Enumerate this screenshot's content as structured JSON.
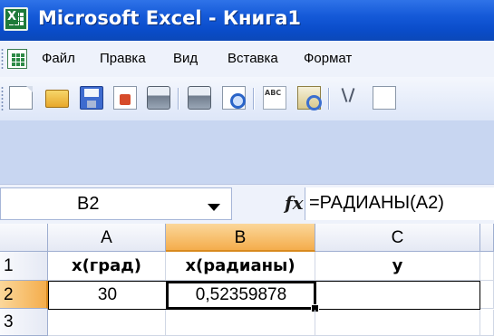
{
  "window": {
    "title": "Microsoft Excel - Книга1",
    "icon": "excel-app-icon"
  },
  "menu": {
    "items": [
      "Файл",
      "Правка",
      "Вид",
      "Вставка",
      "Формат"
    ]
  },
  "toolbar": {
    "icons": [
      "new-icon",
      "open-icon",
      "save-icon",
      "permission-icon",
      "print-icon",
      "print-preview-icon",
      "spelling-icon",
      "research-icon",
      "cut-icon",
      "copy-icon"
    ]
  },
  "formula_bar": {
    "name_box": "B2",
    "fx_icon": "fx-icon",
    "formula": "=РАДИАНЫ(A2)"
  },
  "sheet": {
    "columns": [
      "A",
      "B",
      "C"
    ],
    "selected_column": "B",
    "rows": [
      "1",
      "2",
      "3"
    ],
    "selected_row": "2",
    "cells": {
      "A1": "x(град)",
      "B1": "x(радианы)",
      "C1": "y",
      "A2": "30",
      "B2": "0,52359878",
      "C2": ""
    },
    "active_cell": "B2"
  }
}
